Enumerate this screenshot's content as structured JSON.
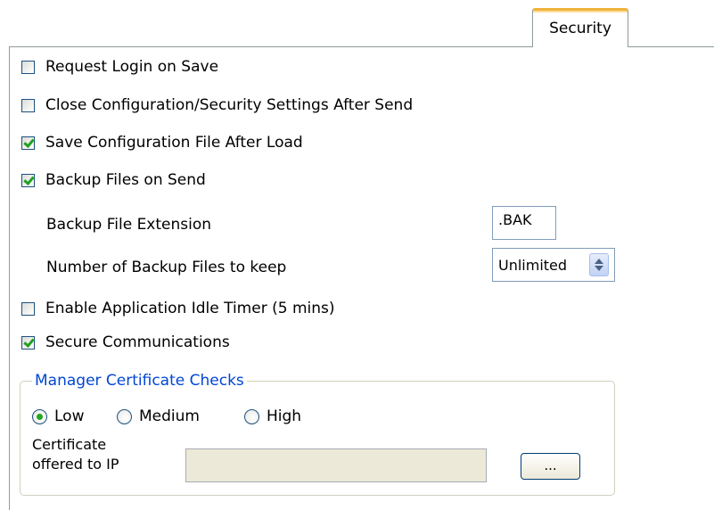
{
  "tab": {
    "label": "Security"
  },
  "options": {
    "request_login": {
      "label": "Request Login on Save",
      "checked": false
    },
    "close_settings": {
      "label": "Close Configuration/Security Settings After Send",
      "checked": false
    },
    "save_config": {
      "label": "Save Configuration File After Load",
      "checked": true
    },
    "backup_files": {
      "label": "Backup Files on Send",
      "checked": true
    },
    "idle_timer": {
      "label": "Enable Application Idle Timer (5 mins)",
      "checked": false
    },
    "secure_comms": {
      "label": "Secure Communications",
      "checked": true
    }
  },
  "backup": {
    "extension_label": "Backup File Extension",
    "extension_value": ".BAK",
    "count_label": "Number of Backup Files to keep",
    "count_value": "Unlimited"
  },
  "cert_checks": {
    "legend": "Manager Certificate Checks",
    "low": {
      "label": "Low",
      "selected": true
    },
    "medium": {
      "label": "Medium",
      "selected": false
    },
    "high": {
      "label": "High",
      "selected": false
    },
    "cert_label_line1": "Certificate",
    "cert_label_line2": "offered to IP",
    "cert_value": "",
    "browse_label": "..."
  }
}
